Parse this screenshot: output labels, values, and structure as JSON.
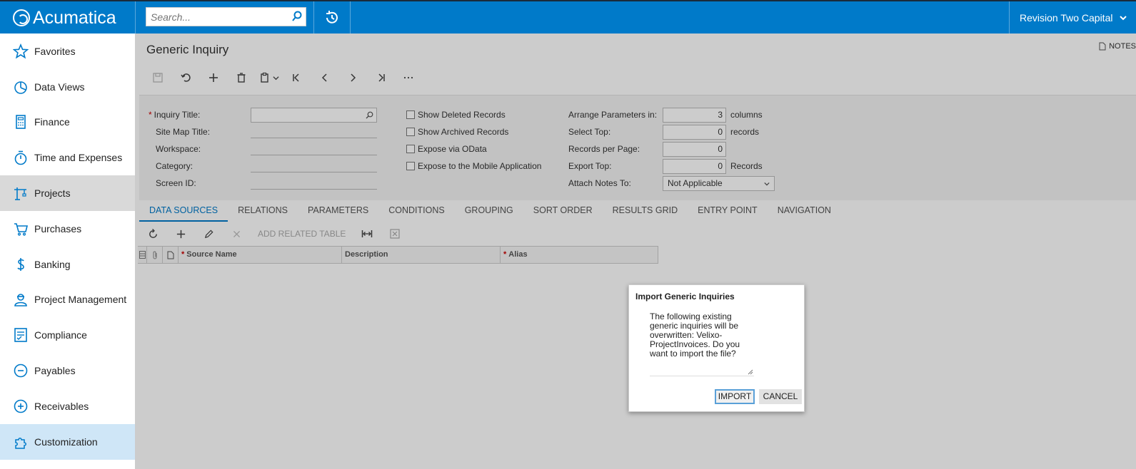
{
  "header": {
    "app_name": "Acumatica",
    "search_placeholder": "Search...",
    "company": "Revision Two Capital"
  },
  "sidebar": {
    "items": [
      {
        "label": "Favorites",
        "icon": "star-icon"
      },
      {
        "label": "Data Views",
        "icon": "pie-chart-icon"
      },
      {
        "label": "Finance",
        "icon": "calculator-icon"
      },
      {
        "label": "Time and Expenses",
        "icon": "stopwatch-icon"
      },
      {
        "label": "Projects",
        "icon": "crane-icon"
      },
      {
        "label": "Purchases",
        "icon": "cart-icon"
      },
      {
        "label": "Banking",
        "icon": "dollar-icon"
      },
      {
        "label": "Project Management",
        "icon": "worker-icon"
      },
      {
        "label": "Compliance",
        "icon": "checklist-icon"
      },
      {
        "label": "Payables",
        "icon": "minus-circle-icon"
      },
      {
        "label": "Receivables",
        "icon": "plus-circle-icon"
      },
      {
        "label": "Customization",
        "icon": "puzzle-icon"
      }
    ]
  },
  "page": {
    "title": "Generic Inquiry",
    "notes_label": "NOTES"
  },
  "form": {
    "inquiry_title_label": "Inquiry Title:",
    "site_map_title_label": "Site Map Title:",
    "workspace_label": "Workspace:",
    "category_label": "Category:",
    "screen_id_label": "Screen ID:",
    "show_deleted": "Show Deleted Records",
    "show_archived": "Show Archived Records",
    "expose_odata": "Expose via OData",
    "expose_mobile": "Expose to the Mobile Application",
    "arrange_label": "Arrange Parameters in:",
    "arrange_value": "3",
    "arrange_unit": "columns",
    "select_top_label": "Select Top:",
    "select_top_value": "0",
    "select_top_unit": "records",
    "records_per_page_label": "Records per Page:",
    "records_per_page_value": "0",
    "export_top_label": "Export Top:",
    "export_top_value": "0",
    "export_top_unit": "Records",
    "attach_notes_label": "Attach Notes To:",
    "attach_notes_value": "Not Applicable"
  },
  "tabs": [
    "DATA SOURCES",
    "RELATIONS",
    "PARAMETERS",
    "CONDITIONS",
    "GROUPING",
    "SORT ORDER",
    "RESULTS GRID",
    "ENTRY POINT",
    "NAVIGATION"
  ],
  "grid": {
    "add_related_table": "ADD RELATED TABLE",
    "columns": [
      "Source Name",
      "Description",
      "Alias"
    ]
  },
  "dialog": {
    "title": "Import Generic Inquiries",
    "message": "The following existing generic inquiries will be overwritten: Velixo-ProjectInvoices. Do you want to import the file?",
    "import_label": "IMPORT",
    "cancel_label": "CANCEL"
  },
  "colors": {
    "brand": "#007ac9",
    "required": "#cc0000"
  }
}
